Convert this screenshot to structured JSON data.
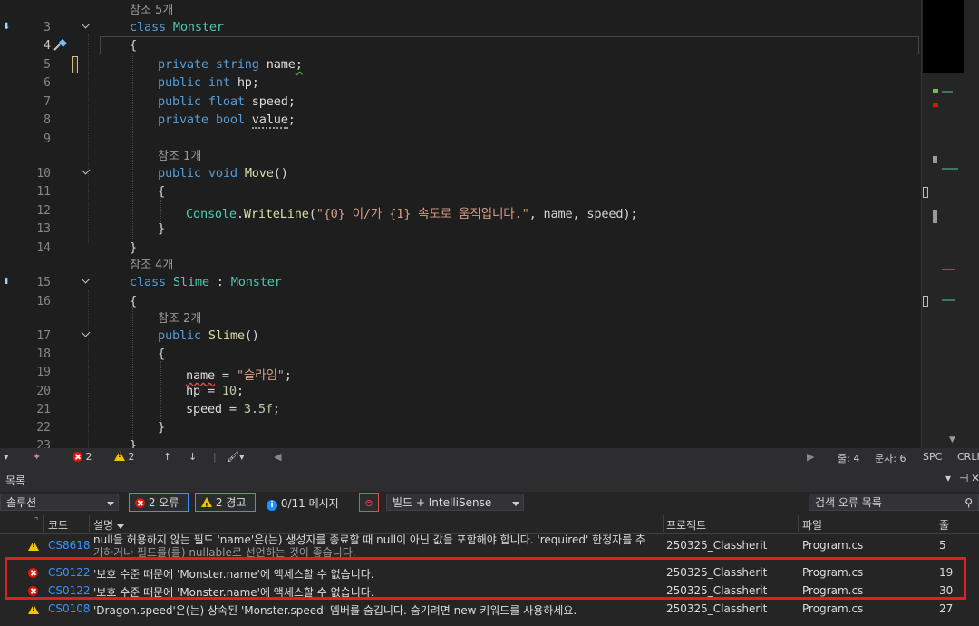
{
  "editor": {
    "refs": {
      "monster": "참조 5개",
      "move": "참조 1개",
      "slime": "참조 4개",
      "slime_ctor": "참조 2개"
    },
    "lines": [
      {
        "num": "3",
        "tokens": [
          [
            "kw",
            "class "
          ],
          [
            "ty",
            "Monster"
          ]
        ]
      },
      {
        "num": "4",
        "tokens": [
          [
            "pl",
            "{"
          ]
        ]
      },
      {
        "num": "5",
        "tokens": [
          [
            "kw",
            "private string "
          ],
          [
            "vr",
            "name"
          ],
          [
            "pl",
            ";"
          ]
        ]
      },
      {
        "num": "6",
        "tokens": [
          [
            "kw",
            "public int "
          ],
          [
            "vr",
            "hp"
          ],
          [
            "pl",
            ";"
          ]
        ]
      },
      {
        "num": "7",
        "tokens": [
          [
            "kw",
            "public float "
          ],
          [
            "vr",
            "speed"
          ],
          [
            "pl",
            ";"
          ]
        ]
      },
      {
        "num": "8",
        "tokens": [
          [
            "kw",
            "private bool "
          ],
          [
            "vr",
            "value"
          ],
          [
            "pl",
            ";"
          ]
        ]
      },
      {
        "num": "9",
        "tokens": []
      },
      {
        "num": "10",
        "tokens": [
          [
            "kw",
            "public void "
          ],
          [
            "fn",
            "Move"
          ],
          [
            "pl",
            "()"
          ]
        ]
      },
      {
        "num": "11",
        "tokens": [
          [
            "pl",
            "{"
          ]
        ]
      },
      {
        "num": "12",
        "tokens": [
          [
            "ty",
            "Console"
          ],
          [
            "pl",
            "."
          ],
          [
            "fn",
            "WriteLine"
          ],
          [
            "pl",
            "("
          ],
          [
            "str",
            "\"{0} 이/가 {1} 속도로 움직입니다.\""
          ],
          [
            "pl",
            ", name, speed);"
          ]
        ]
      },
      {
        "num": "13",
        "tokens": [
          [
            "pl",
            "}"
          ]
        ]
      },
      {
        "num": "14",
        "tokens": []
      },
      {
        "num": "15",
        "tokens": [
          [
            "kw",
            "class "
          ],
          [
            "ty",
            "Slime"
          ],
          [
            "pl",
            " : "
          ],
          [
            "ty",
            "Monster"
          ]
        ]
      },
      {
        "num": "16",
        "tokens": [
          [
            "pl",
            "{"
          ]
        ]
      },
      {
        "num": "17",
        "tokens": [
          [
            "kw",
            "public "
          ],
          [
            "fn",
            "Slime"
          ],
          [
            "pl",
            "()"
          ]
        ]
      },
      {
        "num": "18",
        "tokens": [
          [
            "pl",
            "{"
          ]
        ]
      },
      {
        "num": "19",
        "tokens": [
          [
            "vr",
            "name"
          ],
          [
            "pl",
            " = "
          ],
          [
            "str",
            "\"슬라임\""
          ],
          [
            "pl",
            ";"
          ]
        ]
      },
      {
        "num": "20",
        "tokens": [
          [
            "vr",
            "hp"
          ],
          [
            "pl",
            " = "
          ],
          [
            "num",
            "10"
          ],
          [
            "pl",
            ";"
          ]
        ]
      },
      {
        "num": "21",
        "tokens": [
          [
            "vr",
            "speed"
          ],
          [
            "pl",
            " = "
          ],
          [
            "num",
            "3.5f"
          ],
          [
            "pl",
            ";"
          ]
        ]
      },
      {
        "num": "22",
        "tokens": [
          [
            "pl",
            "}"
          ]
        ]
      },
      {
        "num": "23",
        "tokens": [
          [
            "pl",
            "}"
          ]
        ]
      }
    ],
    "line14_brace": "}"
  },
  "statusbar": {
    "errors": "2",
    "warnings": "2",
    "line": "줄: 4",
    "col": "문자: 6",
    "spc": "SPC",
    "eol": "CRLF"
  },
  "errorlist": {
    "title": "목록",
    "scope": "솔루션",
    "errors_btn": "2 오류",
    "warnings_btn": "2 경고",
    "messages_btn": "0/11 메시지",
    "build_filter": "빌드 + IntelliSense",
    "search_placeholder": "검색 오류 목록",
    "headers": {
      "code": "코드",
      "desc": "설명",
      "project": "프로젝트",
      "file": "파일",
      "line": "줄"
    },
    "rows": [
      {
        "kind": "warning",
        "code": "CS8618",
        "desc1": "null을 허용하지 않는 필드 'name'은(는) 생성자를 종료할 때 null이 아닌 값을 포함해야 합니다. 'required' 한정자를 추",
        "desc2": "가하거나 필드를(를) nullable로 선언하는 것이 좋습니다.",
        "project": "250325_Classherit",
        "file": "Program.cs",
        "line": "5"
      },
      {
        "kind": "error",
        "code": "CS0122",
        "desc1": "'보호 수준 때문에 'Monster.name'에 액세스할 수 없습니다.",
        "project": "250325_Classherit",
        "file": "Program.cs",
        "line": "19"
      },
      {
        "kind": "error",
        "code": "CS0122",
        "desc1": "'보호 수준 때문에 'Monster.name'에 액세스할 수 없습니다.",
        "project": "250325_Classherit",
        "file": "Program.cs",
        "line": "30"
      },
      {
        "kind": "warning",
        "code": "CS0108",
        "desc1": "'Dragon.speed'은(는) 상속된 'Monster.speed' 멤버를 숨깁니다. 숨기려면 new 키워드를 사용하세요.",
        "project": "250325_Classherit",
        "file": "Program.cs",
        "line": "27"
      }
    ]
  },
  "colors": {
    "error": "#e51400",
    "warning": "#f0c400",
    "highlight": "#e02020",
    "keyword": "#569cd6",
    "type": "#4ec9b0"
  }
}
